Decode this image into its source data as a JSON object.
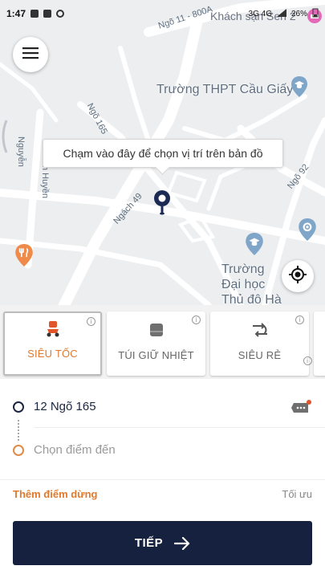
{
  "status_bar": {
    "time": "1:47",
    "network": "3G 4G",
    "battery": "26%"
  },
  "map": {
    "streets": [
      "Ngõ 11 - 800A",
      "Ngõ 165",
      "Nguyễn",
      "n Huyền",
      "Ngách 49",
      "Ngõ 92"
    ],
    "pois": [
      {
        "name": "Trường THPT Cầu Giấy"
      },
      {
        "name": "Trường Đại học Thủ đô Hà Nội"
      },
      {
        "name": "Khách sạn Sen 2"
      }
    ],
    "tooltip": "Chạm vào đây để chọn vị trí trên bản đồ",
    "pin_color": "#1b2a55"
  },
  "services": [
    {
      "label": "SIÊU TỐC",
      "icon": "scooter-icon",
      "selected": true
    },
    {
      "label": "TÚI GIỮ NHIỆT",
      "icon": "thermal-bag-icon",
      "selected": false
    },
    {
      "label": "SIÊU RẺ",
      "icon": "route-icon",
      "selected": false
    }
  ],
  "pickup": {
    "address": "12 Ngõ 165"
  },
  "destination": {
    "placeholder": "Chọn điểm đến"
  },
  "stops": {
    "add_label": "Thêm điểm dừng",
    "optimize_label": "Tối ưu"
  },
  "next_button": {
    "label": "TIẾP"
  },
  "colors": {
    "accent": "#e07a2e",
    "primary": "#15213f",
    "map_bg": "#eceef0"
  }
}
